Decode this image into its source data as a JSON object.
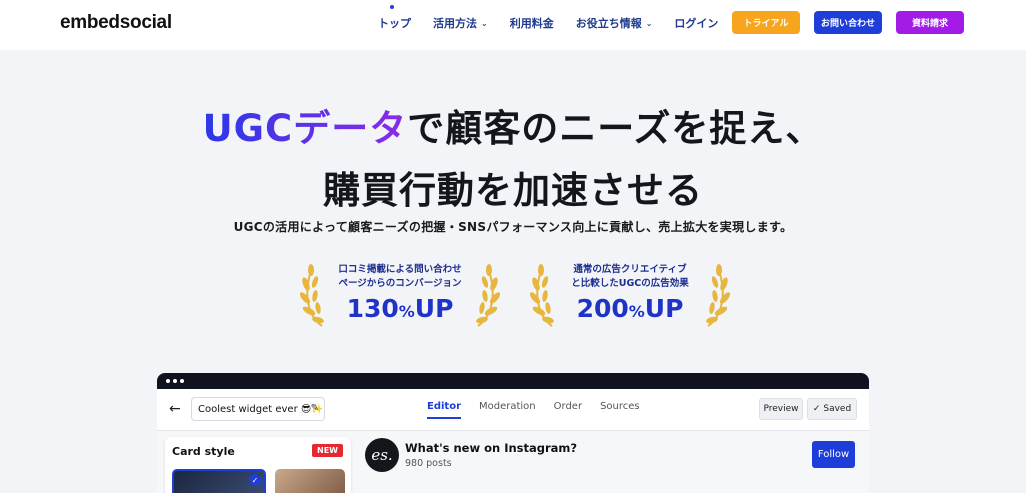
{
  "brand": {
    "logo_text": "embedsocial"
  },
  "nav": {
    "items": [
      {
        "label": "トップ",
        "active": true,
        "dropdown": false
      },
      {
        "label": "活用方法",
        "active": false,
        "dropdown": true
      },
      {
        "label": "利用料金",
        "active": false,
        "dropdown": false
      },
      {
        "label": "お役立ち情報",
        "active": false,
        "dropdown": true
      },
      {
        "label": "ログイン",
        "active": false,
        "dropdown": false
      }
    ],
    "buttons": {
      "trial": "トライアル",
      "contact": "お問い合わせ",
      "docs": "資料請求"
    }
  },
  "hero": {
    "title_highlight": "UGCデータ",
    "title_rest": "で顧客のニーズを捉え、",
    "title_line2": "購買行動を加速させる",
    "subtitle": "UGCの活用によって顧客ニーズの把握・SNSパフォーマンス向上に貢献し、売上拡大を実現します。"
  },
  "awards": [
    {
      "line1": "口コミ掲載による問い合わせ",
      "line2": "ページからのコンバージョン",
      "value": "130",
      "unit": "%",
      "suffix": "UP"
    },
    {
      "line1": "通常の広告クリエイティブ",
      "line2": "と比較したUGCの広告効果",
      "value": "200",
      "unit": "%",
      "suffix": "UP"
    }
  ],
  "app": {
    "widget_name": "Coolest widget ever 😎✨",
    "tabs": [
      "Editor",
      "Moderation",
      "Order",
      "Sources"
    ],
    "active_tab": "Editor",
    "preview_label": "Preview",
    "saved_label": "Saved",
    "card_style_title": "Card style",
    "new_badge": "NEW",
    "profile": {
      "avatar_text": "es.",
      "title": "What's new on Instagram?",
      "posts": "980 posts",
      "follow_label": "Follow"
    }
  },
  "colors": {
    "accent_blue": "#1d3ed8",
    "trial_orange": "#f7a51c",
    "docs_purple": "#a21be6",
    "gold": "#e6b63e"
  }
}
